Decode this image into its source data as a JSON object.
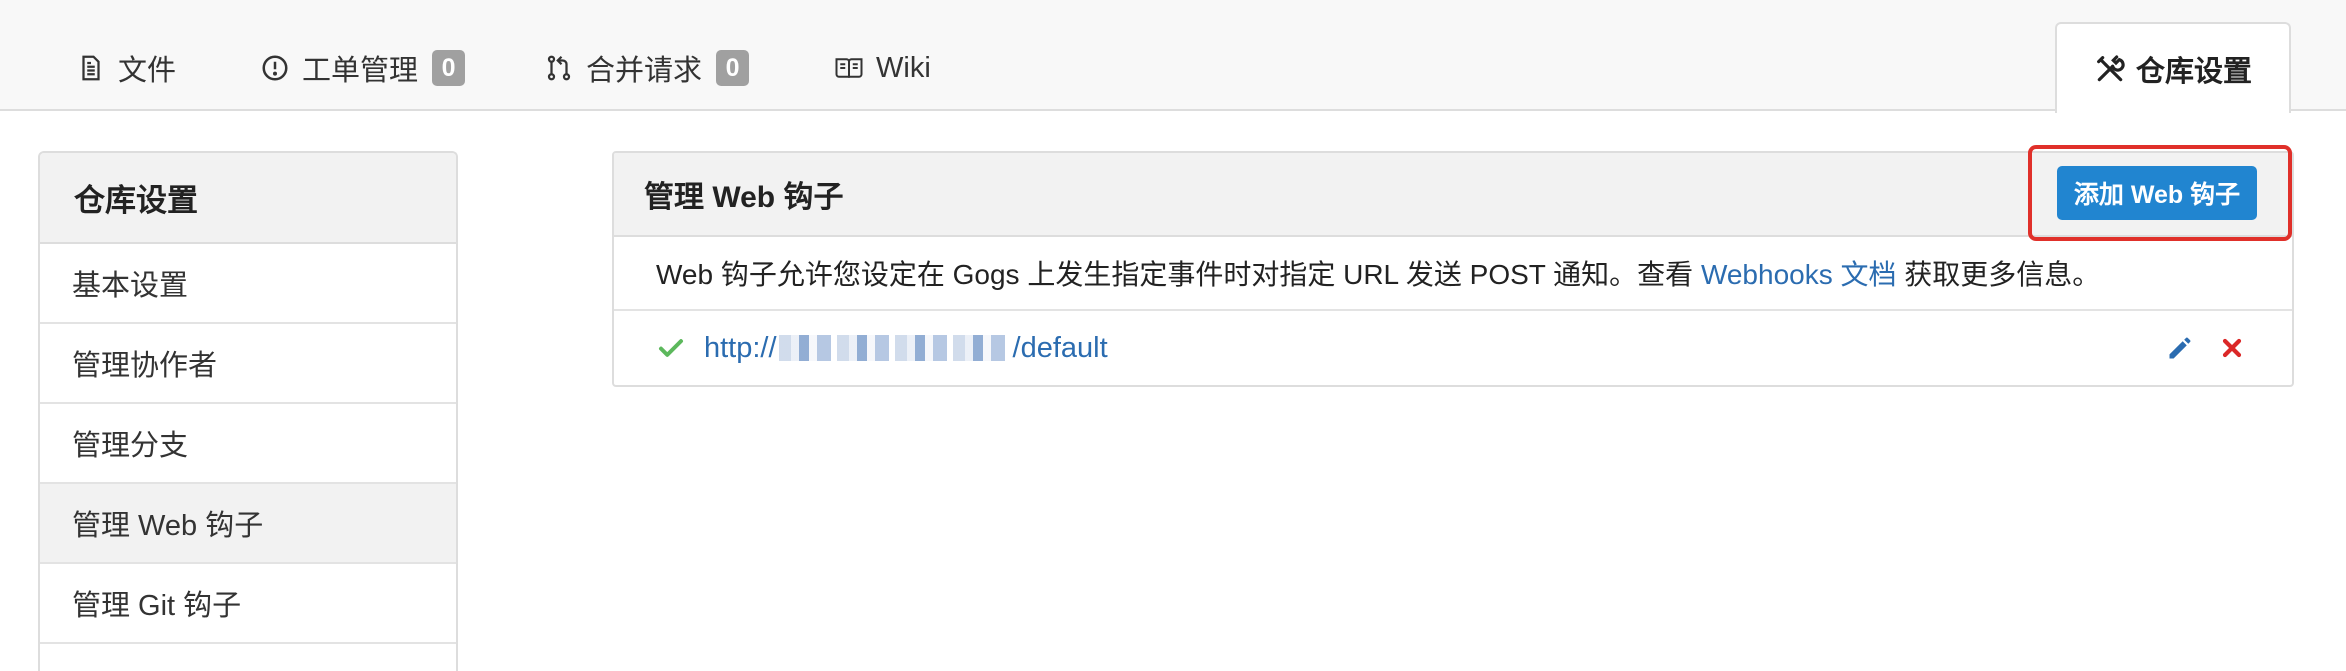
{
  "tabs": {
    "files": {
      "label": "文件",
      "icon": "file-text-icon"
    },
    "issues": {
      "label": "工单管理",
      "count": "0",
      "icon": "issue-opened-icon"
    },
    "pulls": {
      "label": "合并请求",
      "count": "0",
      "icon": "git-pull-request-icon"
    },
    "wiki": {
      "label": "Wiki",
      "icon": "book-icon"
    },
    "settings": {
      "label": "仓库设置",
      "icon": "tools-icon",
      "active": true
    }
  },
  "sidebar": {
    "title": "仓库设置",
    "items": [
      {
        "label": "基本设置"
      },
      {
        "label": "管理协作者"
      },
      {
        "label": "管理分支"
      },
      {
        "label": "管理 Web 钩子",
        "active": true
      },
      {
        "label": "管理 Git 钩子"
      }
    ]
  },
  "panel": {
    "title": "管理 Web 钩子",
    "add_button": "添加 Web 钩子",
    "description_before": "Web 钩子允许您设定在 Gogs 上发生指定事件时对指定 URL 发送 POST 通知。查看 ",
    "description_link": "Webhooks 文档",
    "description_after": " 获取更多信息。"
  },
  "webhooks": [
    {
      "url_prefix": "http://",
      "url_suffix": "/default",
      "status": "success"
    }
  ],
  "colors": {
    "primary": "#2185d0",
    "link": "#2b6cb0",
    "success": "#5cb85c",
    "danger": "#db2828",
    "highlight": "#e0302a",
    "badge": "#a0a0a0"
  }
}
